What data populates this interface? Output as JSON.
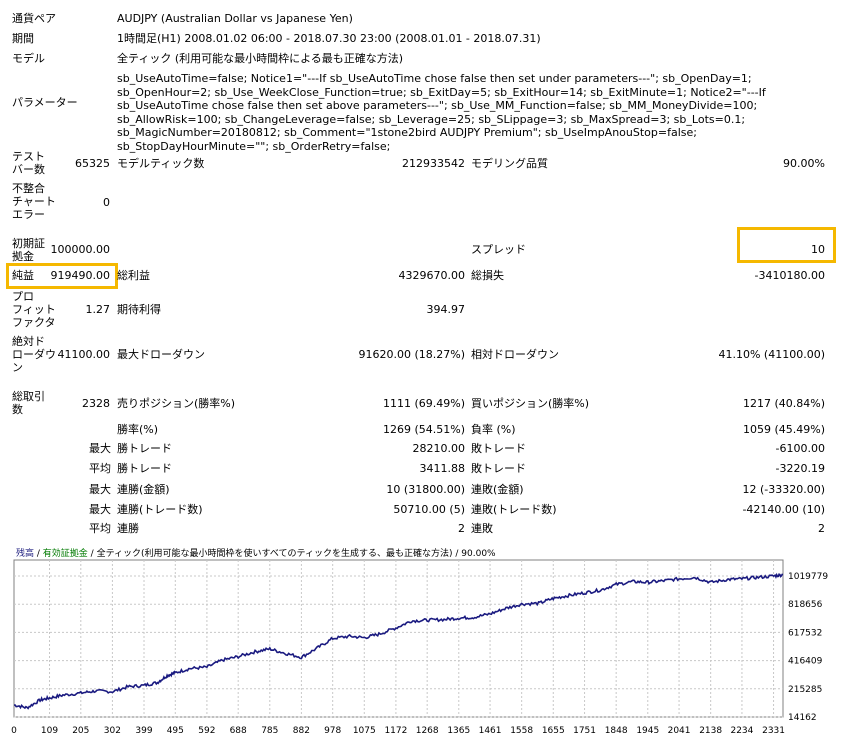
{
  "summary": {
    "currency_pair_label": "通貨ペア",
    "currency_pair_value": "AUDJPY (Australian Dollar vs Japanese Yen)",
    "period_label": "期間",
    "period_value": "1時間足(H1) 2008.01.02 06:00 - 2018.07.30 23:00 (2008.01.01 - 2018.07.31)",
    "model_label": "モデル",
    "model_value": "全ティック (利用可能な最小時間枠による最も正確な方法)",
    "params_label": "パラメーター",
    "params_value": "sb_UseAutoTime=false; Notice1=\"---If sb_UseAutoTime chose false then set under parameters---\"; sb_OpenDay=1; sb_OpenHour=2; sb_Use_WeekClose_Function=true; sb_ExitDay=5; sb_ExitHour=14; sb_ExitMinute=1; Notice2=\"---If sb_UseAutoTime chose false then set above parameters---\"; sb_Use_MM_Function=false; sb_MM_MoneyDivide=100; sb_AllowRisk=100; sb_ChangeLeverage=false; sb_Leverage=25; sb_SLippage=3; sb_MaxSpread=3; sb_Lots=0.1; sb_MagicNumber=20180812; sb_Comment=\"1stone2bird AUDJPY Premium\"; sb_UseImpAnouStop=false; sb_StopDayHourMinute=\"\"; sb_OrderRetry=false;"
  },
  "stats": {
    "test_bars_label_1": "テスト",
    "test_bars_label_2": "バー数",
    "test_bars_value": "65325",
    "model_ticks_label": "モデルティック数",
    "model_ticks_value": "212933542",
    "model_quality_label": "モデリング品質",
    "model_quality_value": "90.00%",
    "mismatch_label_1": "不整合",
    "mismatch_label_2": "チャート",
    "mismatch_label_3": "エラー",
    "mismatch_value": "0",
    "initial_deposit_label_1": "初期証",
    "initial_deposit_label_2": "拠金",
    "initial_deposit_value": "100000.00",
    "spread_label": "スプレッド",
    "spread_value": "10",
    "net_profit_label": "純益",
    "net_profit_value": "919490.00",
    "gross_profit_label": "総利益",
    "gross_profit_value": "4329670.00",
    "gross_loss_label": "総損失",
    "gross_loss_value": "-3410180.00",
    "pf_label_1": "プロ",
    "pf_label_2": "フィット",
    "pf_label_3": "ファクタ",
    "pf_value": "1.27",
    "expected_label": "期待利得",
    "expected_value": "394.97",
    "abs_dd_label_1": "絶対ド",
    "abs_dd_label_2": "ローダウ",
    "abs_dd_label_3": "ン",
    "abs_dd_value": "41100.00",
    "max_dd_label": "最大ドローダウン",
    "max_dd_value": "91620.00 (18.27%)",
    "rel_dd_label": "相対ドローダウン",
    "rel_dd_value": "41.10% (41100.00)",
    "total_trades_label_1": "総取引",
    "total_trades_label_2": "数",
    "total_trades_value": "2328",
    "short_label": "売りポジション(勝率%)",
    "short_value": "1111 (69.49%)",
    "long_label": "買いポジション(勝率%)",
    "long_value": "1217 (40.84%)",
    "win_rate_label": "勝率(%)",
    "win_rate_value": "1269 (54.51%)",
    "loss_rate_label": "負率 (%)",
    "loss_rate_value": "1059 (45.49%)",
    "max1": "最大",
    "largest_win_label": "勝トレード",
    "largest_win_value": "28210.00",
    "largest_loss_label": "敗トレード",
    "largest_loss_value": "-6100.00",
    "avg1": "平均",
    "avg_win_label": "勝トレード",
    "avg_win_value": "3411.88",
    "avg_loss_label": "敗トレード",
    "avg_loss_value": "-3220.19",
    "max2": "最大",
    "cons_win_amt_label": "連勝(金額)",
    "cons_win_amt_value": "10 (31800.00)",
    "cons_loss_amt_label": "連敗(金額)",
    "cons_loss_amt_value": "12 (-33320.00)",
    "max3": "最大",
    "cons_win_cnt_label": "連勝(トレード数)",
    "cons_win_cnt_value": "50710.00 (5)",
    "cons_loss_cnt_label": "連敗(トレード数)",
    "cons_loss_cnt_value": "-42140.00 (10)",
    "avg2": "平均",
    "avg_cons_win_label": "連勝",
    "avg_cons_win_value": "2",
    "avg_cons_loss_label": "連敗",
    "avg_cons_loss_value": "2"
  },
  "legend": {
    "balance": "残高",
    "sep1": " / ",
    "margin": "有効証拠金",
    "sep2": " / ",
    "model": "全ティック(利用可能な最小時間枠を使いすべてのティックを生成する、最も正確な方法)",
    "sep3": " / ",
    "quality": "90.00%"
  },
  "colors": {
    "line": "#1a1a80",
    "grid": "#c8c8c8",
    "highlight": "#f5b800"
  },
  "chart_data": {
    "type": "line",
    "title": "",
    "xlabel": "",
    "ylabel": "",
    "ylim": [
      14162,
      1120000
    ],
    "xlim": [
      0,
      2360
    ],
    "x_ticks": [
      "0",
      "109",
      "205",
      "302",
      "399",
      "495",
      "592",
      "688",
      "785",
      "882",
      "978",
      "1075",
      "1172",
      "1268",
      "1365",
      "1461",
      "1558",
      "1655",
      "1751",
      "1848",
      "1945",
      "2041",
      "2138",
      "2234",
      "2331"
    ],
    "y_ticks": [
      "1019779",
      "818656",
      "617532",
      "416409",
      "215285",
      "14162"
    ],
    "grid": true,
    "series": [
      {
        "x": [
          0,
          40,
          80,
          109,
          150,
          205,
          250,
          302,
          350,
          399,
          440,
          470,
          495,
          540,
          592,
          640,
          688,
          740,
          785,
          830,
          882,
          930,
          978,
          1030,
          1075,
          1120,
          1172,
          1220,
          1268,
          1320,
          1365,
          1410,
          1461,
          1510,
          1558,
          1610,
          1655,
          1700,
          1751,
          1800,
          1848,
          1900,
          1945,
          1990,
          2041,
          2090,
          2138,
          2190,
          2234,
          2280,
          2331,
          2360
        ],
        "y": [
          100000,
          80000,
          135000,
          150000,
          170000,
          185000,
          200000,
          195000,
          230000,
          240000,
          260000,
          310000,
          330000,
          360000,
          370000,
          420000,
          445000,
          480000,
          500000,
          470000,
          440000,
          505000,
          575000,
          590000,
          580000,
          605000,
          650000,
          700000,
          705000,
          710000,
          720000,
          725000,
          750000,
          790000,
          820000,
          825000,
          860000,
          880000,
          900000,
          920000,
          960000,
          980000,
          975000,
          985000,
          1000000,
          1010000,
          975000,
          995000,
          1000000,
          1010000,
          1020000,
          1030000
        ]
      }
    ]
  }
}
